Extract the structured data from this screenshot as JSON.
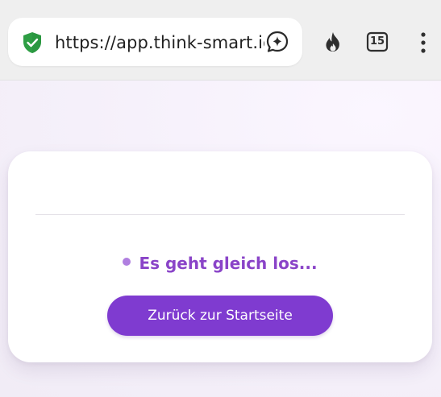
{
  "browser": {
    "url": "https://app.think-smart.ic",
    "tab_count": "15",
    "icons": {
      "security": "shield-check-icon",
      "assistant": "sparkle-chat-icon",
      "flame": "flame-icon",
      "tabs": "tab-switcher-icon",
      "menu": "more-vertical-icon"
    }
  },
  "page": {
    "status_text": "Es geht gleich los...",
    "back_button_label": "Zurück zur Startseite"
  },
  "colors": {
    "accent": "#7f3bd0",
    "status_text": "#8a44c8",
    "status_dot": "#b07fe0",
    "security_green": "#2e9e44"
  }
}
